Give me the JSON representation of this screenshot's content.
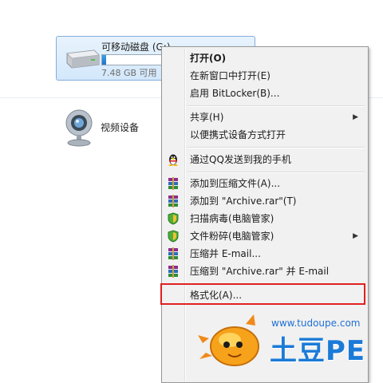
{
  "drive": {
    "name": "可移动磁盘 (G:)",
    "free_text": "7.48 GB 可用",
    "used_fraction": 0.03
  },
  "device": {
    "label": "视频设备"
  },
  "context_menu": {
    "items": [
      {
        "label": "打开(O)",
        "bold": true
      },
      {
        "label": "在新窗口中打开(E)"
      },
      {
        "label": "启用 BitLocker(B)..."
      },
      {
        "label": "共享(H)",
        "submenu": true
      },
      {
        "label": "以便携式设备方式打开"
      },
      {
        "label": "通过QQ发送到我的手机",
        "icon": "qq-penguin-icon"
      },
      {
        "label": "添加到压缩文件(A)...",
        "icon": "winrar-icon"
      },
      {
        "label": "添加到 \"Archive.rar\"(T)",
        "icon": "winrar-icon"
      },
      {
        "label": "扫描病毒(电脑管家)",
        "icon": "shield-icon"
      },
      {
        "label": "文件粉碎(电脑管家)",
        "icon": "shield-icon",
        "submenu": true
      },
      {
        "label": "压缩并 E-mail...",
        "icon": "winrar-icon"
      },
      {
        "label": "压缩到 \"Archive.rar\" 并 E-mail",
        "icon": "winrar-icon"
      },
      {
        "label": "格式化(A)...",
        "highlighted": true
      }
    ],
    "submenu_arrow": "▶"
  },
  "watermark": {
    "url": "www.tudoupe.com",
    "brand": "土豆PE"
  },
  "colors": {
    "highlight_border": "#e02020",
    "selection_fill": "#d3e8fb",
    "brand_blue": "#1a7ad8"
  }
}
